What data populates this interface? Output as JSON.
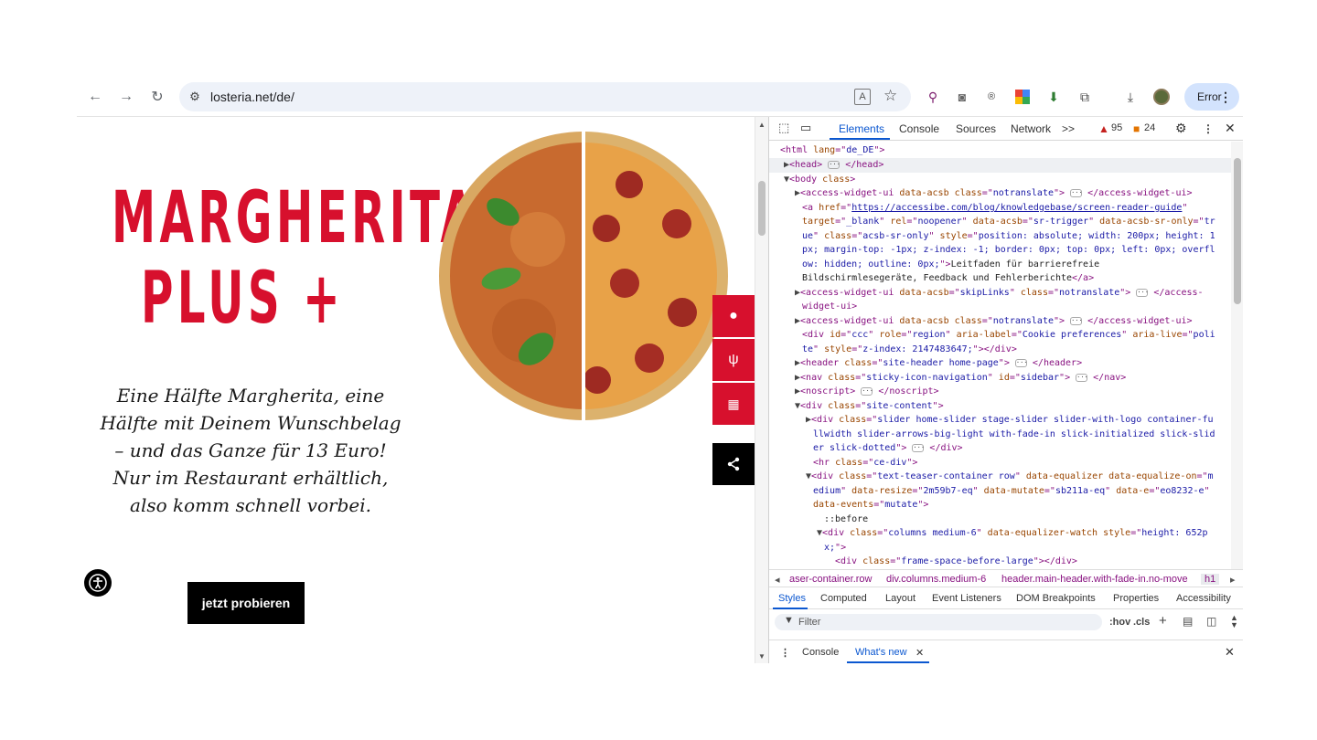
{
  "browser": {
    "url": "losteria.net/de/",
    "error_label": "Error",
    "icons": [
      "back-icon",
      "forward-icon",
      "reload-icon",
      "tune-icon",
      "translate-icon",
      "star-icon",
      "download-icon",
      "avatar"
    ]
  },
  "site": {
    "title_line1": "MARGHERITA",
    "title_line2": "PLUS +",
    "tagline": [
      "Eine Hälfte Margherita, eine",
      "Hälfte mit Deinem Wunschbelag",
      "– und das Ganze für 13 Euro!",
      "Nur im Restaurant erhältlich,",
      "also komm schnell vorbei."
    ],
    "cta_label": "jetzt probieren",
    "accent_color": "#d7102d"
  },
  "devtools": {
    "tabs": [
      "Elements",
      "Console",
      "Sources",
      "Network"
    ],
    "more": ">>",
    "warnings": "95",
    "issues": "24",
    "breadcrumbs": [
      "aser-container.row",
      "div.columns.medium-6",
      "header.main-header.with-fade-in.no-move",
      "h1"
    ],
    "styles_tabs": [
      "Styles",
      "Computed",
      "Layout",
      "Event Listeners",
      "DOM Breakpoints",
      "Properties",
      "Accessibility"
    ],
    "filter_placeholder": "Filter",
    "hov": ":hov",
    "cls": ".cls",
    "drawer_tabs": [
      "Console",
      "What's new"
    ]
  }
}
